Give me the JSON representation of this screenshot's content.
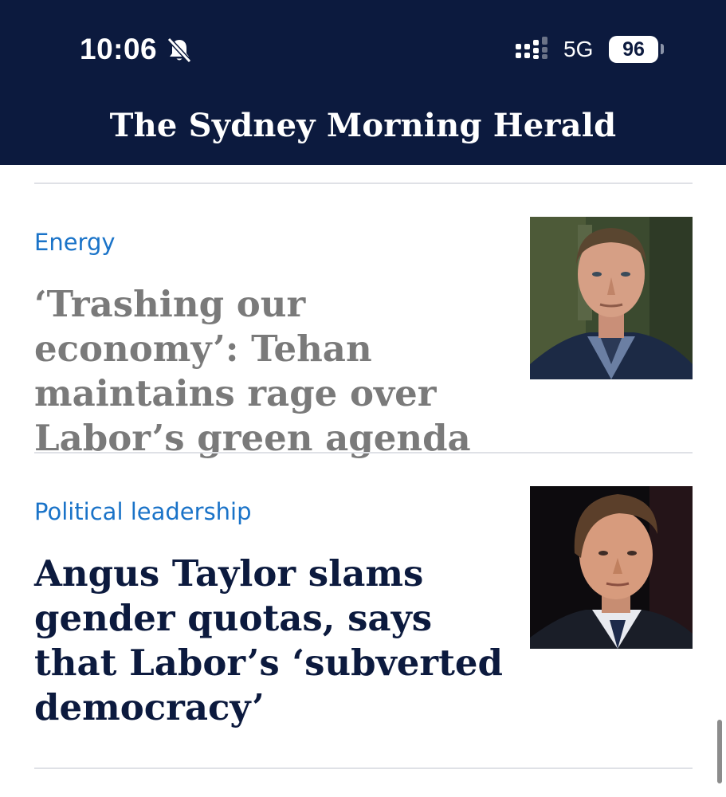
{
  "status_bar": {
    "time": "10:06",
    "network": "5G",
    "battery": "96",
    "icons": [
      "bell-slash-icon",
      "signal-icon"
    ]
  },
  "header": {
    "masthead": "The Sydney Morning Herald",
    "background_color": "#0c1a3e"
  },
  "articles": [
    {
      "section": "Energy",
      "headline": "‘Trashing our economy’: Tehan maintains rage over Labor’s green agenda",
      "state": "read",
      "image_icon": "portrait-photo-icon"
    },
    {
      "section": "Political leadership",
      "headline": "Angus Taylor slams gender quotas, says that Labor’s ‘subverted democracy’",
      "state": "unread",
      "image_icon": "portrait-photo-icon"
    }
  ],
  "colors": {
    "section_tag": "#1a73c8",
    "headline_read": "#7a7a7a",
    "headline_unread": "#0c1a3e",
    "divider": "#dfe1e6"
  }
}
